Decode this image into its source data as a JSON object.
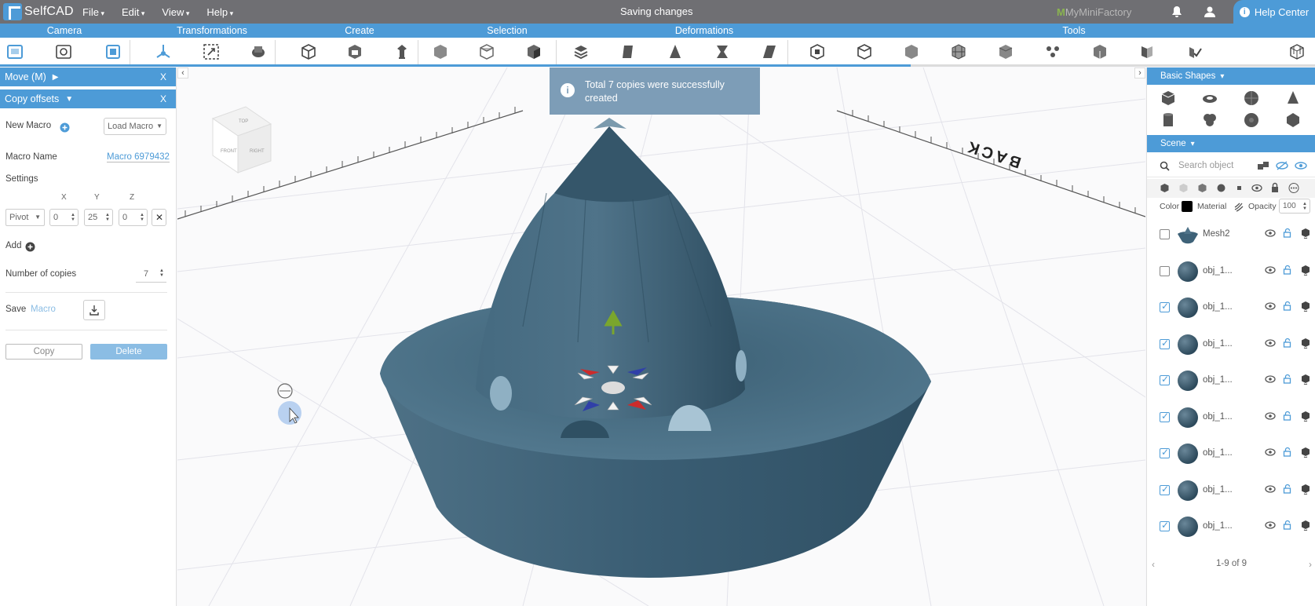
{
  "app": {
    "logo_text": "SelfCAD",
    "menus": [
      "File",
      "Edit",
      "View",
      "Help"
    ],
    "status": "Saving changes",
    "mmf_label": "MyMiniFactory",
    "help_center": "Help Center"
  },
  "ribbon": {
    "groups": [
      "Camera",
      "Transformations",
      "Create",
      "Selection",
      "Deformations",
      "Tools"
    ]
  },
  "left_panel": {
    "move_title": "Move (M)",
    "copy_title": "Copy offsets",
    "close": "X",
    "new_macro": "New Macro",
    "load_macro": "Load Macro",
    "macro_name_label": "Macro Name",
    "macro_name_value": "Macro 6979432",
    "settings": "Settings",
    "axis_x": "X",
    "axis_y": "Y",
    "axis_z": "Z",
    "pivot": "Pivot",
    "x_value": "0",
    "y_value": "25",
    "z_value": "0",
    "add": "Add",
    "copies_label": "Number of copies",
    "copies_value": "7",
    "save": "Save",
    "save_macro": "Macro",
    "copy_button": "Copy",
    "delete_button": "Delete"
  },
  "viewport": {
    "toast": "Total 7 copies were successfully created",
    "back_label": "BACK",
    "cube_faces": [
      "TOP",
      "FRONT",
      "RIGHT"
    ]
  },
  "right_panel": {
    "basic_shapes": "Basic Shapes",
    "scene": "Scene",
    "search_placeholder": "Search object",
    "color_label": "Color",
    "material_label": "Material",
    "opacity_label": "Opacity",
    "opacity_value": "100",
    "objects": [
      {
        "name": "Mesh2",
        "checked": false
      },
      {
        "name": "obj_1...",
        "checked": false
      },
      {
        "name": "obj_1...",
        "checked": true
      },
      {
        "name": "obj_1...",
        "checked": true
      },
      {
        "name": "obj_1...",
        "checked": true
      },
      {
        "name": "obj_1...",
        "checked": true
      },
      {
        "name": "obj_1...",
        "checked": true
      },
      {
        "name": "obj_1...",
        "checked": true
      },
      {
        "name": "obj_1...",
        "checked": true
      }
    ],
    "pager": "1-9 of 9"
  },
  "colors": {
    "accent": "#4d9bd7",
    "topbar": "#6f6f73",
    "model": "#3e6278"
  }
}
